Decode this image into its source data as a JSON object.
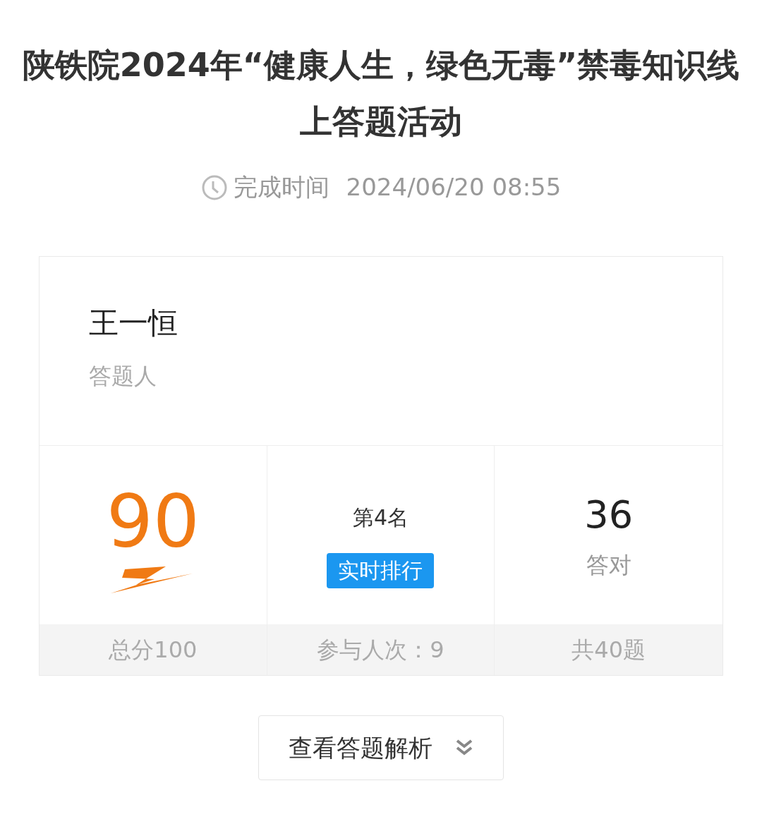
{
  "title": "陕铁院2024年“健康人生，绿色无毒”禁毒知识线上答题活动",
  "completion": {
    "label": "完成时间",
    "time": "2024/06/20 08:55"
  },
  "respondent": {
    "name": "王一恒",
    "label": "答题人"
  },
  "stats": [
    {
      "kind": "score",
      "value": "90",
      "footer": "总分100"
    },
    {
      "kind": "rank",
      "value": "第4名",
      "button": "实时排行",
      "footer": "参与人次：9"
    },
    {
      "kind": "correct",
      "value": "36",
      "label": "答对",
      "footer": "共40题"
    }
  ],
  "analysis_button": "查看答题解析"
}
